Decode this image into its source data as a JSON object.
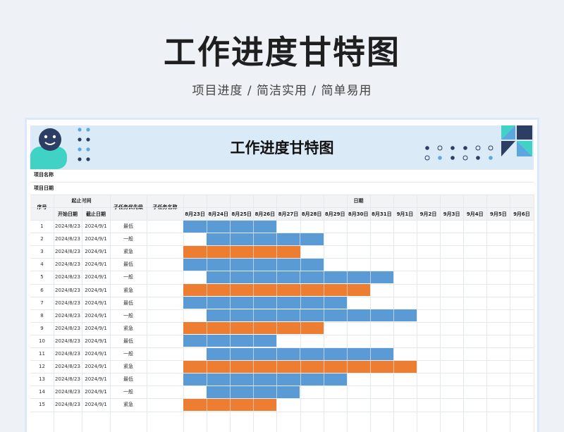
{
  "page": {
    "title": "工作进度甘特图",
    "subtitle": "项目进度 / 简洁实用 / 简单易用"
  },
  "sheet": {
    "banner_title": "工作进度甘特图",
    "project_name_label": "项目名称",
    "project_date_label": "项目日期",
    "headers": {
      "index": "序号",
      "period": "起止时间",
      "start": "开始日期",
      "end": "截止日期",
      "priority": "子任务优先级",
      "task_name": "子任务名称",
      "date": "日期"
    },
    "dates": [
      "8月23日",
      "8月24日",
      "8月25日",
      "8月26日",
      "8月27日",
      "8月28日",
      "8月29日",
      "8月30日",
      "8月31日",
      "9月1日",
      "9月2日",
      "9月3日",
      "9月4日",
      "9月5日",
      "9月6日"
    ],
    "colors": {
      "normal": "#5b9bd5",
      "urgent": "#ed7d31",
      "banner": "#dbeaf7"
    },
    "rows": [
      {
        "index": "1",
        "start": "2024/8/23",
        "end": "2024/9/1",
        "priority": "最低",
        "type": "normal",
        "bar_start": 0,
        "bar_days": 4
      },
      {
        "index": "2",
        "start": "2024/8/23",
        "end": "2024/9/1",
        "priority": "一般",
        "type": "normal",
        "bar_start": 1,
        "bar_days": 5
      },
      {
        "index": "3",
        "start": "2024/8/23",
        "end": "2024/9/1",
        "priority": "紧急",
        "type": "urgent",
        "bar_start": 0,
        "bar_days": 5
      },
      {
        "index": "4",
        "start": "2024/8/23",
        "end": "2024/9/1",
        "priority": "最低",
        "type": "normal",
        "bar_start": 0,
        "bar_days": 6
      },
      {
        "index": "5",
        "start": "2024/8/23",
        "end": "2024/9/1",
        "priority": "一般",
        "type": "normal",
        "bar_start": 1,
        "bar_days": 8
      },
      {
        "index": "6",
        "start": "2024/8/23",
        "end": "2024/9/1",
        "priority": "紧急",
        "type": "urgent",
        "bar_start": 0,
        "bar_days": 8
      },
      {
        "index": "7",
        "start": "2024/8/23",
        "end": "2024/9/1",
        "priority": "最低",
        "type": "normal",
        "bar_start": 0,
        "bar_days": 7
      },
      {
        "index": "8",
        "start": "2024/8/23",
        "end": "2024/9/1",
        "priority": "一般",
        "type": "normal",
        "bar_start": 1,
        "bar_days": 9
      },
      {
        "index": "9",
        "start": "2024/8/23",
        "end": "2024/9/1",
        "priority": "紧急",
        "type": "urgent",
        "bar_start": 0,
        "bar_days": 6
      },
      {
        "index": "10",
        "start": "2024/8/23",
        "end": "2024/9/1",
        "priority": "最低",
        "type": "normal",
        "bar_start": 0,
        "bar_days": 4
      },
      {
        "index": "11",
        "start": "2024/8/23",
        "end": "2024/9/1",
        "priority": "一般",
        "type": "normal",
        "bar_start": 1,
        "bar_days": 8
      },
      {
        "index": "12",
        "start": "2024/8/23",
        "end": "2024/9/1",
        "priority": "紧急",
        "type": "urgent",
        "bar_start": 0,
        "bar_days": 10
      },
      {
        "index": "13",
        "start": "2024/8/23",
        "end": "2024/9/1",
        "priority": "最低",
        "type": "normal",
        "bar_start": 0,
        "bar_days": 7
      },
      {
        "index": "14",
        "start": "2024/8/23",
        "end": "2024/9/1",
        "priority": "一般",
        "type": "normal",
        "bar_start": 1,
        "bar_days": 4
      },
      {
        "index": "15",
        "start": "2024/8/23",
        "end": "2024/9/1",
        "priority": "紧急",
        "type": "urgent",
        "bar_start": 0,
        "bar_days": 4
      }
    ]
  }
}
